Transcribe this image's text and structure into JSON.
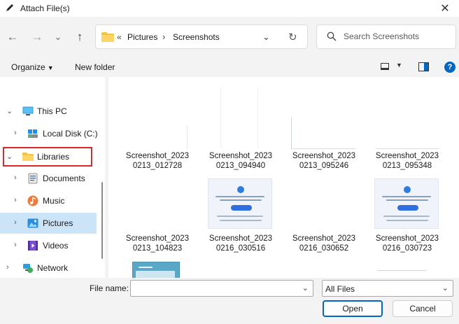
{
  "window": {
    "title": "Attach File(s)",
    "close_glyph": "✕"
  },
  "nav": {
    "back": "←",
    "forward": "→",
    "recent": "⌄",
    "up": "↑"
  },
  "address": {
    "separator0": "«",
    "crumbs": [
      "Pictures",
      "Screenshots"
    ],
    "separator": "›",
    "dropdown": "⌄",
    "refresh": "↻"
  },
  "search": {
    "placeholder": "Search Screenshots"
  },
  "toolbar": {
    "organize": "Organize",
    "new_folder": "New folder",
    "help": "?"
  },
  "sidebar": {
    "items": [
      {
        "label": "This PC",
        "chevron": "⌄",
        "icon": "monitor-icon"
      },
      {
        "label": "Local Disk (C:)",
        "chevron": "›",
        "icon": "drive-icon"
      },
      {
        "label": "Libraries",
        "chevron": "⌄",
        "icon": "folder-icon",
        "highlighted": true
      },
      {
        "label": "Documents",
        "chevron": "›",
        "icon": "documents-icon"
      },
      {
        "label": "Music",
        "chevron": "›",
        "icon": "music-icon"
      },
      {
        "label": "Pictures",
        "chevron": "›",
        "icon": "pictures-icon",
        "selected": true
      },
      {
        "label": "Videos",
        "chevron": "›",
        "icon": "videos-icon"
      },
      {
        "label": "Network",
        "chevron": "›",
        "icon": "network-icon"
      }
    ]
  },
  "files": [
    {
      "name": "Screenshot_2023\n0213_012728"
    },
    {
      "name": "Screenshot_2023\n0213_094940"
    },
    {
      "name": "Screenshot_2023\n0213_095246"
    },
    {
      "name": "Screenshot_2023\n0213_095348"
    },
    {
      "name": "Screenshot_2023\n0213_104823"
    },
    {
      "name": "Screenshot_2023\n0216_030516"
    },
    {
      "name": "Screenshot_2023\n0216_030652"
    },
    {
      "name": "Screenshot_2023\n0216_030723"
    }
  ],
  "bottom": {
    "file_name_label": "File name:",
    "file_name_value": "",
    "filter_value": "All Files",
    "open_label": "Open",
    "cancel_label": "Cancel"
  },
  "colors": {
    "accent": "#0067c0",
    "highlight_border": "#d9262b",
    "selection": "#cce4f7"
  }
}
